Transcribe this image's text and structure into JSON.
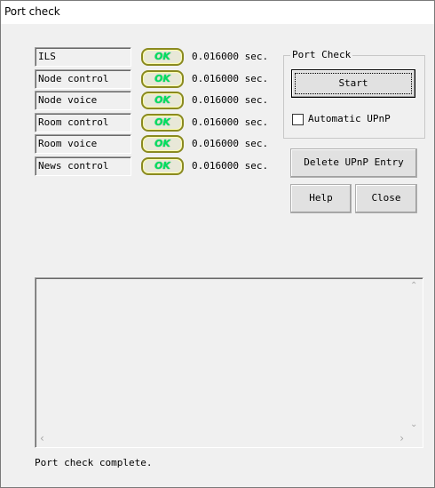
{
  "window": {
    "title": "Port check"
  },
  "ports": [
    {
      "label": "ILS",
      "status": "OK",
      "time": "0.016000 sec."
    },
    {
      "label": "Node control",
      "status": "OK",
      "time": "0.016000 sec."
    },
    {
      "label": "Node voice",
      "status": "OK",
      "time": "0.016000 sec."
    },
    {
      "label": "Room control",
      "status": "OK",
      "time": "0.016000 sec."
    },
    {
      "label": "Room voice",
      "status": "OK",
      "time": "0.016000 sec."
    },
    {
      "label": "News control",
      "status": "OK",
      "time": "0.016000 sec."
    }
  ],
  "port_check_group": {
    "legend": "Port Check",
    "start_label": "Start",
    "upnp_checkbox_label": "Automatic UPnP",
    "upnp_checked": false
  },
  "buttons": {
    "delete_upnp": "Delete UPnP Entry",
    "help": "Help",
    "close": "Close"
  },
  "log": {
    "text": ""
  },
  "status": {
    "text": "Port check complete."
  },
  "icons": {
    "scroll_up": "chevron-up-icon",
    "scroll_down": "chevron-down-icon",
    "scroll_left": "chevron-left-icon",
    "scroll_right": "chevron-right-icon"
  }
}
